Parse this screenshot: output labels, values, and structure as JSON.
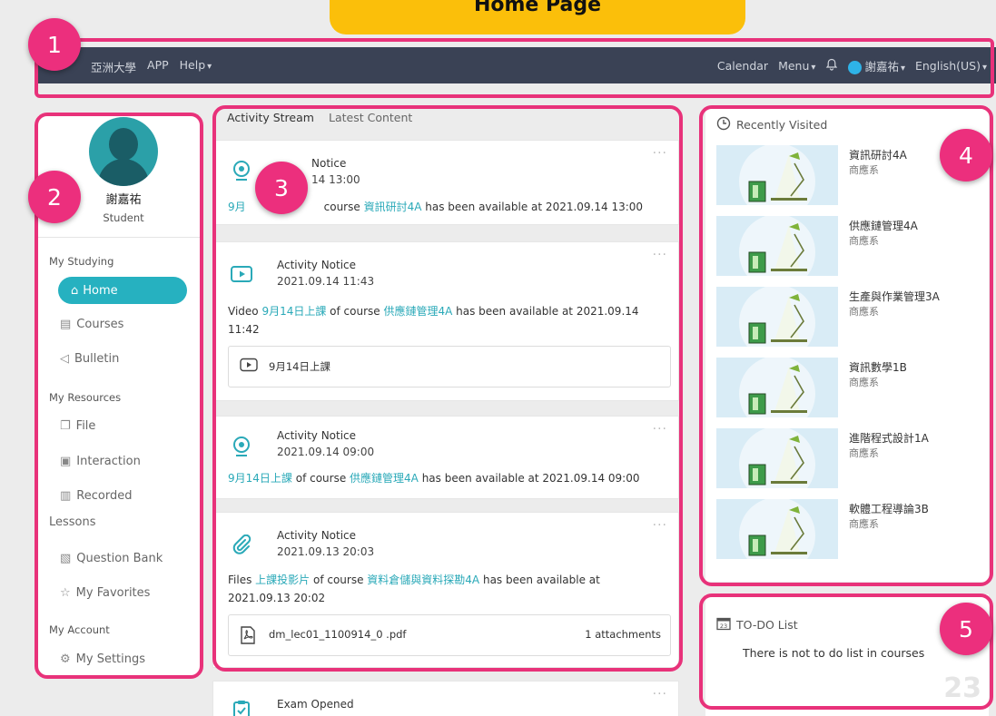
{
  "page_title": "Home Page",
  "topnav": {
    "brand": "亞洲大學",
    "app": "APP",
    "help": "Help",
    "calendar": "Calendar",
    "menu": "Menu",
    "user": "謝嘉祐",
    "language": "English(US)"
  },
  "profile": {
    "name": "謝嘉祐",
    "role": "Student"
  },
  "sidebar": {
    "my_studying": "My Studying",
    "home": "Home",
    "courses": "Courses",
    "bulletin": "Bulletin",
    "my_resources": "My Resources",
    "file": "File",
    "interaction": "Interaction",
    "recorded": "Recorded",
    "lessons": "Lessons",
    "question_bank": "Question Bank",
    "my_favorites": "My Favorites",
    "my_account": "My Account",
    "my_settings": "My Settings"
  },
  "stream": {
    "tabs": [
      "Activity Stream",
      "Latest Content"
    ],
    "more": "···",
    "cards": [
      {
        "title": "Notice",
        "date": "14 13:00",
        "prefix": "9月",
        "mid": "course ",
        "course": "資訊研討4A",
        "suffix": " has been available at 2021.09.14 13:00"
      },
      {
        "title": "Activity Notice",
        "date": "2021.09.14 11:43",
        "prefix": "Video ",
        "item": "9月14日上課",
        "mid": " of course ",
        "course": "供應鏈管理4A",
        "suffix": " has been available at 2021.09.14 11:42",
        "attachment": "9月14日上課"
      },
      {
        "title": "Activity Notice",
        "date": "2021.09.14 09:00",
        "item": "9月14日上課",
        "mid": " of course ",
        "course": "供應鏈管理4A",
        "suffix": " has been available at 2021.09.14 09:00"
      },
      {
        "title": "Activity Notice",
        "date": "2021.09.13 20:03",
        "prefix": "Files ",
        "item": "上課投影片",
        "mid": " of course ",
        "course": "資料倉儲與資料探勘4A",
        "suffix": " has been available at 2021.09.13 20:02",
        "attachment": "dm_lec01_1100914_0 .pdf",
        "attachment_count": "1 attachments"
      },
      {
        "title": "Exam Opened"
      }
    ]
  },
  "recent": {
    "heading": "Recently Visited",
    "items": [
      {
        "name": "資訊研討4A",
        "dept": "商應系"
      },
      {
        "name": "供應鏈管理4A",
        "dept": "商應系"
      },
      {
        "name": "生產與作業管理3A",
        "dept": "商應系"
      },
      {
        "name": "資訊數學1B",
        "dept": "商應系"
      },
      {
        "name": "進階程式設計1A",
        "dept": "商應系"
      },
      {
        "name": "軟體工程導論3B",
        "dept": "商應系"
      }
    ]
  },
  "todo": {
    "heading": "TO-DO List",
    "message": "There is not to do list in courses",
    "calendar_icon_day": "23",
    "watermark": "23"
  },
  "markers": [
    "1",
    "2",
    "3",
    "4",
    "5"
  ],
  "colors": {
    "accent": "#26b1c0",
    "link": "#2aa9b8",
    "highlight": "#e8327a",
    "banner": "#fbbf0a",
    "nav_bg": "#3a4255"
  }
}
